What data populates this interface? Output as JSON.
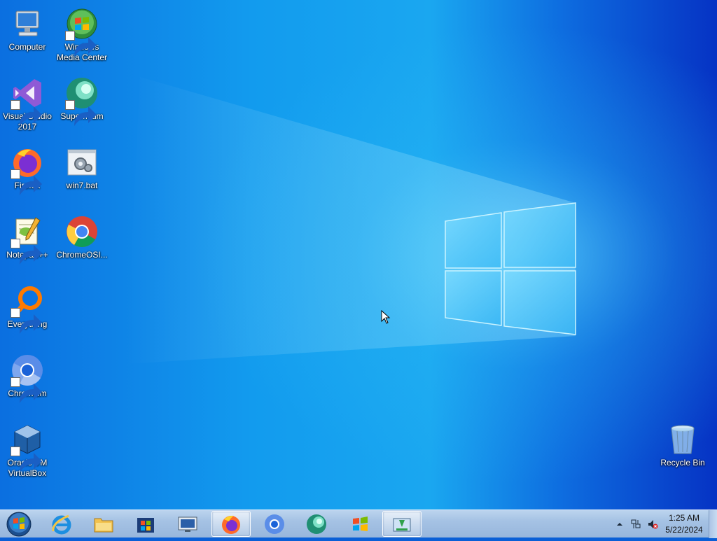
{
  "desktop": {
    "icons": [
      {
        "label": "Computer",
        "icon": "computer-icon"
      },
      {
        "label": "Windows Media Center",
        "icon": "windows-media-center-icon"
      },
      {
        "label": "Visual Studio 2017",
        "icon": "visual-studio-icon"
      },
      {
        "label": "Supermium",
        "icon": "supermium-icon"
      },
      {
        "label": "Firefox",
        "icon": "firefox-icon"
      },
      {
        "label": "win7.bat",
        "icon": "bat-file-icon"
      },
      {
        "label": "Notepad++",
        "icon": "notepadpp-icon"
      },
      {
        "label": "ChromeOSI...",
        "icon": "chrome-icon"
      },
      {
        "label": "Everything",
        "icon": "everything-search-icon"
      },
      {
        "label": "Chromium",
        "icon": "chromium-icon"
      },
      {
        "label": "Oracle VM VirtualBox",
        "icon": "virtualbox-icon"
      },
      {
        "label": "Recycle Bin",
        "icon": "recycle-bin-icon"
      }
    ]
  },
  "taskbar": {
    "start": "start-orb-icon",
    "buttons": [
      {
        "icon": "internet-explorer-icon",
        "active": false
      },
      {
        "icon": "file-explorer-icon",
        "active": false
      },
      {
        "icon": "microsoft-store-icon",
        "active": false
      },
      {
        "icon": "remote-desktop-icon",
        "active": false
      },
      {
        "icon": "firefox-icon",
        "active": true
      },
      {
        "icon": "chromium-icon",
        "active": false
      },
      {
        "icon": "supermium-icon",
        "active": false
      },
      {
        "icon": "windows-media-center-icon",
        "active": false
      },
      {
        "icon": "download-installer-icon",
        "active": true
      }
    ],
    "tray": {
      "icons": [
        "show-hidden-icons-arrow",
        "network-icon",
        "volume-muted-icon"
      ],
      "time": "1:25 AM",
      "date": "5/22/2024"
    }
  },
  "colors": {
    "wallpaper_dark": "#0637c6",
    "wallpaper_light": "#1ab3f2",
    "taskbar": "#a5c2e4"
  }
}
